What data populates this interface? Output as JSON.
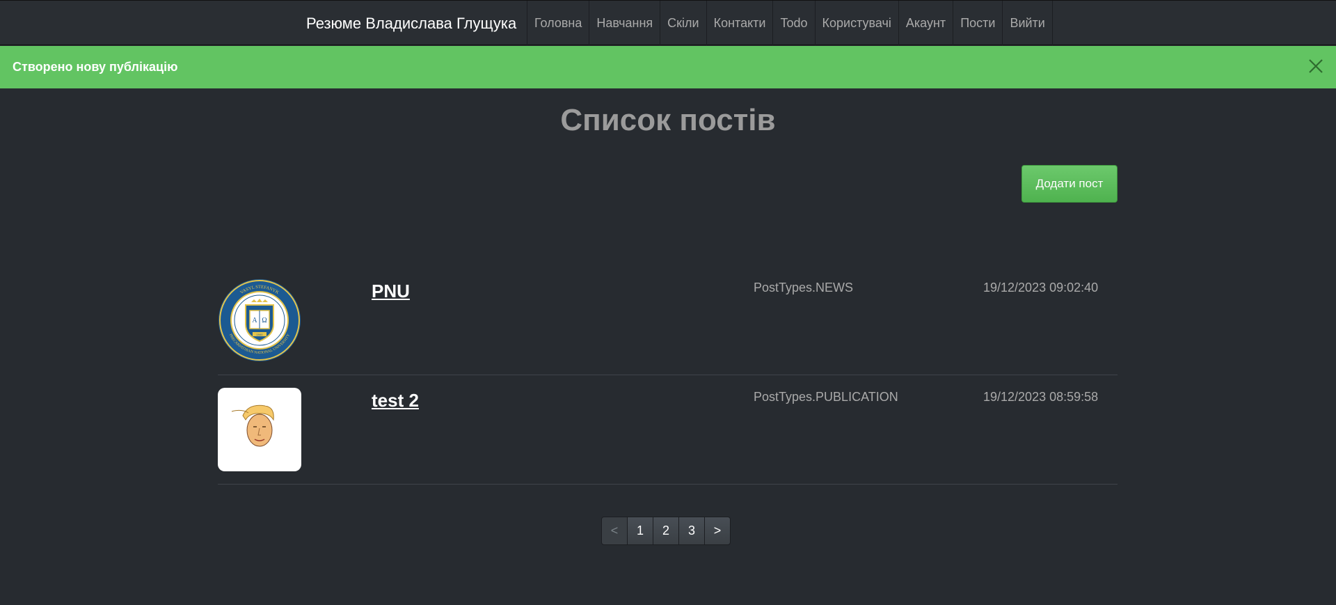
{
  "navbar": {
    "brand": "Резюме Владислава Глущука",
    "items": [
      "Головна",
      "Навчання",
      "Скіли",
      "Контакти",
      "Todo",
      "Користувачі",
      "Акаунт",
      "Пости",
      "Вийти"
    ]
  },
  "alert": {
    "message": "Створено нову публікацію"
  },
  "page": {
    "title": "Список постів",
    "add_button_label": "Додати пост"
  },
  "posts": [
    {
      "title": "PNU",
      "type": "PostTypes.NEWS",
      "date": "19/12/2023 09:02:40",
      "image": "university-seal-icon",
      "seal_text": "VASYL STEFANYK PRECARPATHIAN NATIONAL UNIVERSITY",
      "seal_year": "1940"
    },
    {
      "title": "test 2",
      "type": "PostTypes.PUBLICATION",
      "date": "19/12/2023 08:59:58",
      "image": "cartoon-face-icon"
    }
  ],
  "pagination": {
    "prev": "<",
    "pages": [
      "1",
      "2",
      "3"
    ],
    "next": ">"
  },
  "colors": {
    "background": "#272b30",
    "navbar": "#2a2e33",
    "alert_success": "#62c462",
    "button_success": "#5cb85c"
  }
}
